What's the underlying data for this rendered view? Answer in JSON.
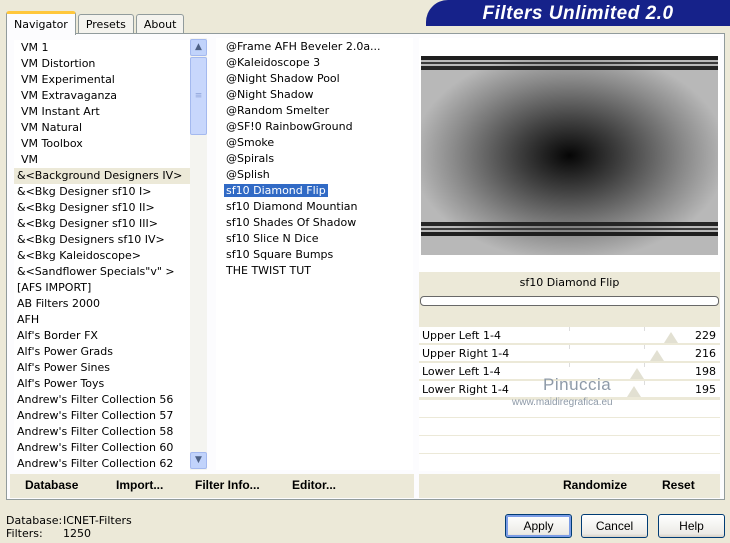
{
  "tabs": [
    "Navigator",
    "Presets",
    "About"
  ],
  "banner_title": "Filters Unlimited 2.0",
  "categories": [
    "VM 1",
    "VM Distortion",
    "VM Experimental",
    "VM Extravaganza",
    "VM Instant Art",
    "VM Natural",
    "VM Toolbox",
    "VM",
    "&<Background Designers IV>",
    "&<Bkg Designer sf10 I>",
    "&<Bkg Designer sf10 II>",
    "&<Bkg Designer sf10 III>",
    "&<Bkg Designers sf10 IV>",
    "&<Bkg Kaleidoscope>",
    "&<Sandflower Specials\"v\" >",
    "[AFS IMPORT]",
    "AB Filters 2000",
    "AFH",
    "Alf's Border FX",
    "Alf's Power Grads",
    "Alf's Power Sines",
    "Alf's Power Toys",
    "Andrew's Filter Collection 56",
    "Andrew's Filter Collection 57",
    "Andrew's Filter Collection 58",
    "Andrew's Filter Collection 60",
    "Andrew's Filter Collection 62"
  ],
  "filters": [
    "@Frame AFH Beveler 2.0a...",
    "@Kaleidoscope 3",
    "@Night Shadow Pool",
    "@Night Shadow",
    "@Random Smelter",
    "@SF!0 RainbowGround",
    "@Smoke",
    "@Spirals",
    "@Splish",
    "sf10 Diamond Flip",
    "sf10 Diamond Mountian",
    "sf10 Shades Of Shadow",
    "sf10 Slice N Dice",
    "sf10 Square Bumps",
    "THE TWIST TUT"
  ],
  "selected_filter_label": "sf10 Diamond Flip",
  "sliders": [
    {
      "label": "Upper Left 1-4",
      "value": "229",
      "level": 229
    },
    {
      "label": "Upper Right 1-4",
      "value": "216",
      "level": 216
    },
    {
      "label": "Lower Left 1-4",
      "value": "198",
      "level": 198
    },
    {
      "label": "Lower Right 1-4",
      "value": "195",
      "level": 195
    }
  ],
  "watermark": {
    "name": "Pinuccia",
    "url": "www.maidiregrafica.eu"
  },
  "actions": {
    "database": "Database",
    "import": "Import...",
    "filter_info": "Filter Info...",
    "editor": "Editor...",
    "randomize": "Randomize",
    "reset": "Reset"
  },
  "status": {
    "database_key": "Database:",
    "database_value": "ICNET-Filters",
    "filters_key": "Filters:",
    "filters_value": "1250"
  },
  "buttons": {
    "apply": "Apply",
    "cancel": "Cancel",
    "help": "Help"
  },
  "colors": {
    "banner": "#16228a",
    "selection": "#316ac5",
    "tab_highlight": "#ffc73c"
  }
}
